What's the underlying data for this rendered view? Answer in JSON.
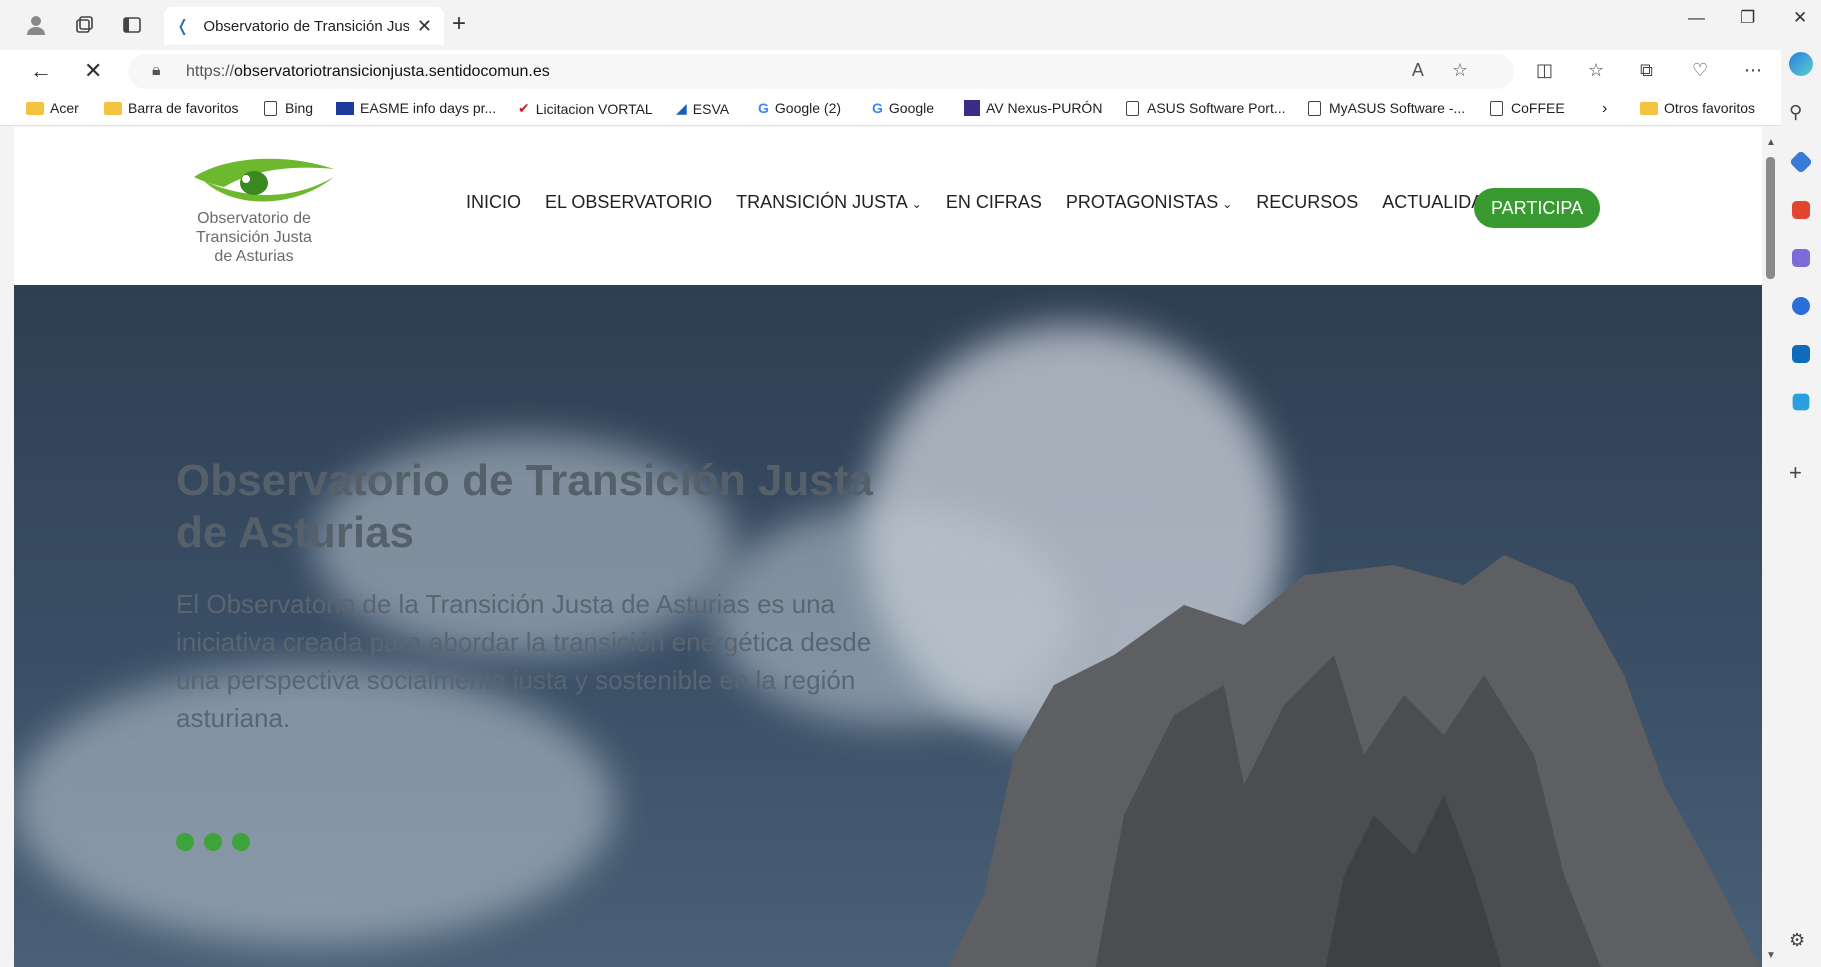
{
  "browser": {
    "tab_title": "Observatorio de Transición Justa",
    "tab_close": "✕",
    "new_tab": "+",
    "url_prefix": "https://",
    "url_host": "observatoriotransicionjusta.sentidocomun.es"
  },
  "favorites": [
    {
      "label": "Acer",
      "icon": "folder"
    },
    {
      "label": "Barra de favoritos",
      "icon": "folder"
    },
    {
      "label": "Bing",
      "icon": "page"
    },
    {
      "label": "EASME info days pr...",
      "icon": "eu-flag"
    },
    {
      "label": "Licitacion VORTAL",
      "icon": "check-red"
    },
    {
      "label": "ESVA",
      "icon": "triangle"
    },
    {
      "label": "Google (2)",
      "icon": "google-g"
    },
    {
      "label": "Google",
      "icon": "google-g"
    },
    {
      "label": "AV Nexus-PURÓN",
      "icon": "nexus"
    },
    {
      "label": "ASUS Software Port...",
      "icon": "page"
    },
    {
      "label": "MyASUS Software -...",
      "icon": "page"
    },
    {
      "label": "CoFFEE",
      "icon": "page"
    },
    {
      "label": "Otros favoritos",
      "icon": "folder"
    }
  ],
  "site": {
    "logo_lines": [
      "Observatorio de",
      "Transición Justa",
      "de Asturias"
    ],
    "menu": [
      {
        "label": "INICIO",
        "dropdown": false
      },
      {
        "label": "EL OBSERVATORIO",
        "dropdown": false
      },
      {
        "label": "TRANSICIÓN JUSTA",
        "dropdown": true
      },
      {
        "label": "EN CIFRAS",
        "dropdown": false
      },
      {
        "label": "PROTAGONISTAS",
        "dropdown": true
      },
      {
        "label": "RECURSOS",
        "dropdown": false
      },
      {
        "label": "ACTUALIDAD",
        "dropdown": false
      }
    ],
    "cta_label": "PARTICIPA",
    "accent_color": "#3a9a32"
  },
  "hero": {
    "title": "Observatorio de Transición Justa de Asturias",
    "subtitle": "El Observatorio de la Transición Justa de Asturias es una iniciativa creada para abordar la transición energética desde una perspectiva socialmente justa y sostenible en la región asturiana.",
    "slider_dots": 3
  }
}
